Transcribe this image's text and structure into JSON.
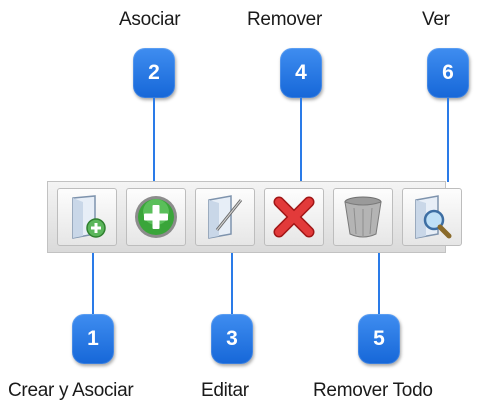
{
  "labels": {
    "asociar": "Asociar",
    "remover": "Remover",
    "ver": "Ver",
    "crear_y_asociar": "Crear y Asociar",
    "editar": "Editar",
    "remover_todo": "Remover Todo"
  },
  "badges": {
    "b1": "1",
    "b2": "2",
    "b3": "3",
    "b4": "4",
    "b5": "5",
    "b6": "6"
  },
  "toolbar": {
    "buttons": [
      {
        "icon": "new-document-plus-icon"
      },
      {
        "icon": "green-plus-icon"
      },
      {
        "icon": "edit-pencil-icon"
      },
      {
        "icon": "red-x-icon"
      },
      {
        "icon": "trash-bin-icon"
      },
      {
        "icon": "magnifier-document-icon"
      }
    ]
  },
  "colors": {
    "badge": "#1667d8",
    "line": "#2a7be8",
    "green": "#3aa53a",
    "red": "#d62b2b"
  }
}
